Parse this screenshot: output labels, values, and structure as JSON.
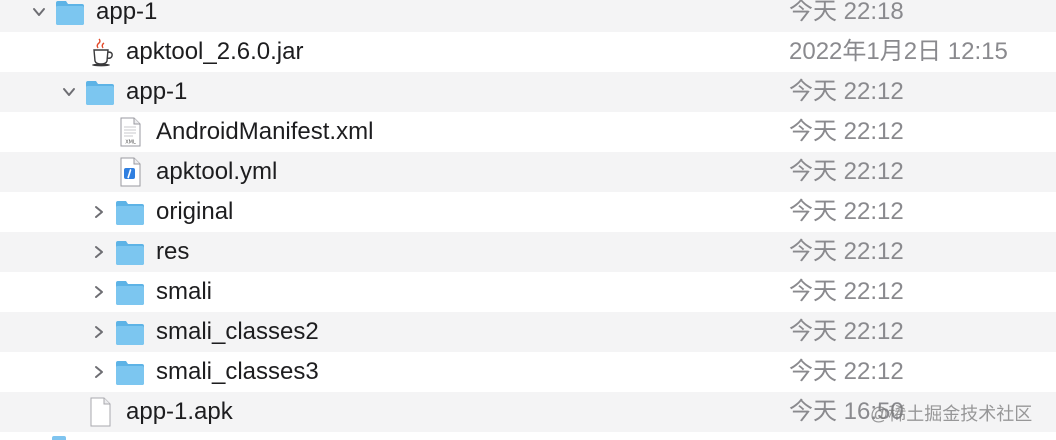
{
  "colors": {
    "folder": "#7cc6f0",
    "folder_dark": "#5db3e6",
    "alt_row": "#f4f4f5",
    "date_text": "#8a8a8e"
  },
  "rows": [
    {
      "name": "app-1",
      "date": "今天 22:18",
      "icon": "folder-icon",
      "disclosure": "expanded"
    },
    {
      "name": "apktool_2.6.0.jar",
      "date": "2022年1月2日 12:15",
      "icon": "java-jar-icon",
      "disclosure": "none"
    },
    {
      "name": "app-1",
      "date": "今天 22:12",
      "icon": "folder-icon",
      "disclosure": "expanded"
    },
    {
      "name": "AndroidManifest.xml",
      "date": "今天 22:12",
      "icon": "xml-file-icon",
      "disclosure": "none"
    },
    {
      "name": "apktool.yml",
      "date": "今天 22:12",
      "icon": "yml-file-icon",
      "disclosure": "none"
    },
    {
      "name": "original",
      "date": "今天 22:12",
      "icon": "folder-icon",
      "disclosure": "collapsed"
    },
    {
      "name": "res",
      "date": "今天 22:12",
      "icon": "folder-icon",
      "disclosure": "collapsed"
    },
    {
      "name": "smali",
      "date": "今天 22:12",
      "icon": "folder-icon",
      "disclosure": "collapsed"
    },
    {
      "name": "smali_classes2",
      "date": "今天 22:12",
      "icon": "folder-icon",
      "disclosure": "collapsed"
    },
    {
      "name": "smali_classes3",
      "date": "今天 22:12",
      "icon": "folder-icon",
      "disclosure": "collapsed"
    },
    {
      "name": "app-1.apk",
      "date": "今天 16:50",
      "icon": "document-icon",
      "disclosure": "none"
    }
  ],
  "watermark": "@稀土掘金技术社区"
}
